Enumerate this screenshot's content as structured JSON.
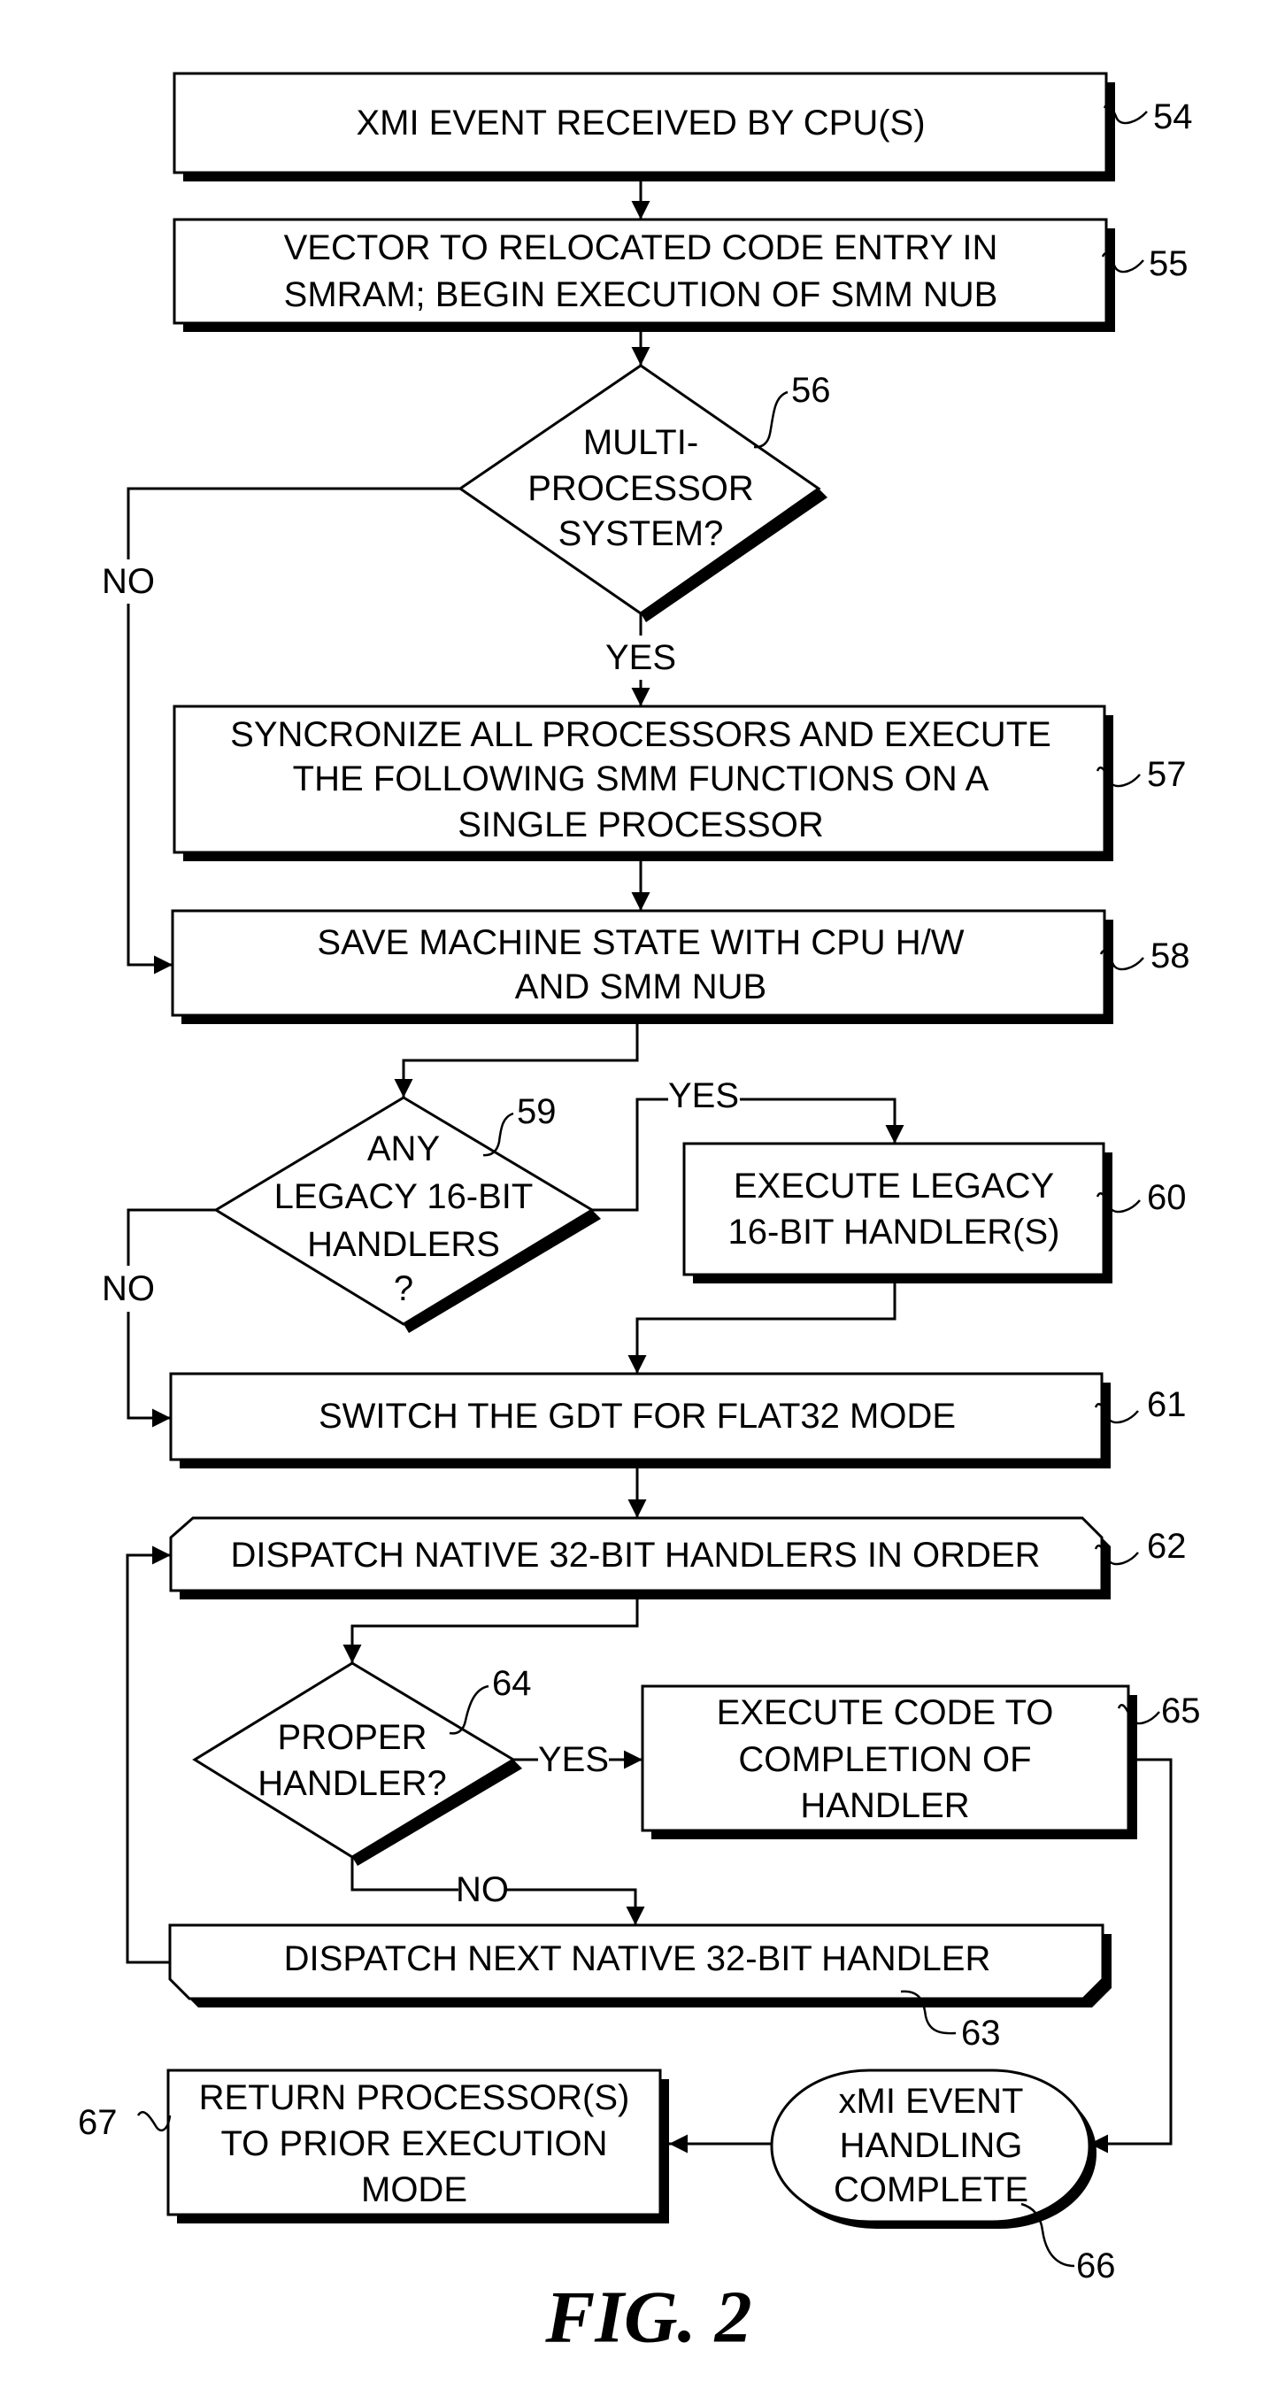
{
  "figure": {
    "caption": "FIG. 2",
    "nodes": {
      "n54": {
        "ref": "54",
        "lines": [
          "XMI EVENT RECEIVED BY CPU(S)"
        ]
      },
      "n55": {
        "ref": "55",
        "lines": [
          "VECTOR TO RELOCATED CODE ENTRY IN",
          "SMRAM; BEGIN EXECUTION OF SMM NUB"
        ]
      },
      "n56": {
        "ref": "56",
        "lines": [
          "MULTI-",
          "PROCESSOR",
          "SYSTEM?"
        ]
      },
      "n57": {
        "ref": "57",
        "lines": [
          "SYNCRONIZE ALL PROCESSORS AND EXECUTE",
          "THE FOLLOWING SMM FUNCTIONS ON A",
          "SINGLE PROCESSOR"
        ]
      },
      "n58": {
        "ref": "58",
        "lines": [
          "SAVE MACHINE STATE WITH CPU H/W",
          "AND SMM NUB"
        ]
      },
      "n59": {
        "ref": "59",
        "lines": [
          "ANY",
          "LEGACY 16-BIT",
          "HANDLERS",
          "?"
        ]
      },
      "n60": {
        "ref": "60",
        "lines": [
          "EXECUTE LEGACY",
          "16-BIT HANDLER(S)"
        ]
      },
      "n61": {
        "ref": "61",
        "lines": [
          "SWITCH THE GDT FOR FLAT32 MODE"
        ]
      },
      "n62": {
        "ref": "62",
        "lines": [
          "DISPATCH NATIVE 32-BIT HANDLERS IN ORDER"
        ]
      },
      "n63": {
        "ref": "63",
        "lines": [
          "DISPATCH NEXT NATIVE 32-BIT HANDLER"
        ]
      },
      "n64": {
        "ref": "64",
        "lines": [
          "PROPER",
          "HANDLER?"
        ]
      },
      "n65": {
        "ref": "65",
        "lines": [
          "EXECUTE CODE TO",
          "COMPLETION OF",
          "HANDLER"
        ]
      },
      "n66": {
        "ref": "66",
        "lines": [
          "xMI EVENT",
          "HANDLING",
          "COMPLETE"
        ]
      },
      "n67": {
        "ref": "67",
        "lines": [
          "RETURN PROCESSOR(S)",
          "TO PRIOR EXECUTION",
          "MODE"
        ]
      }
    },
    "edge_labels": {
      "n56_no": "NO",
      "n56_yes": "YES",
      "n59_yes": "YES",
      "n59_no": "NO",
      "n64_yes": "YES",
      "n64_no": "NO"
    }
  }
}
